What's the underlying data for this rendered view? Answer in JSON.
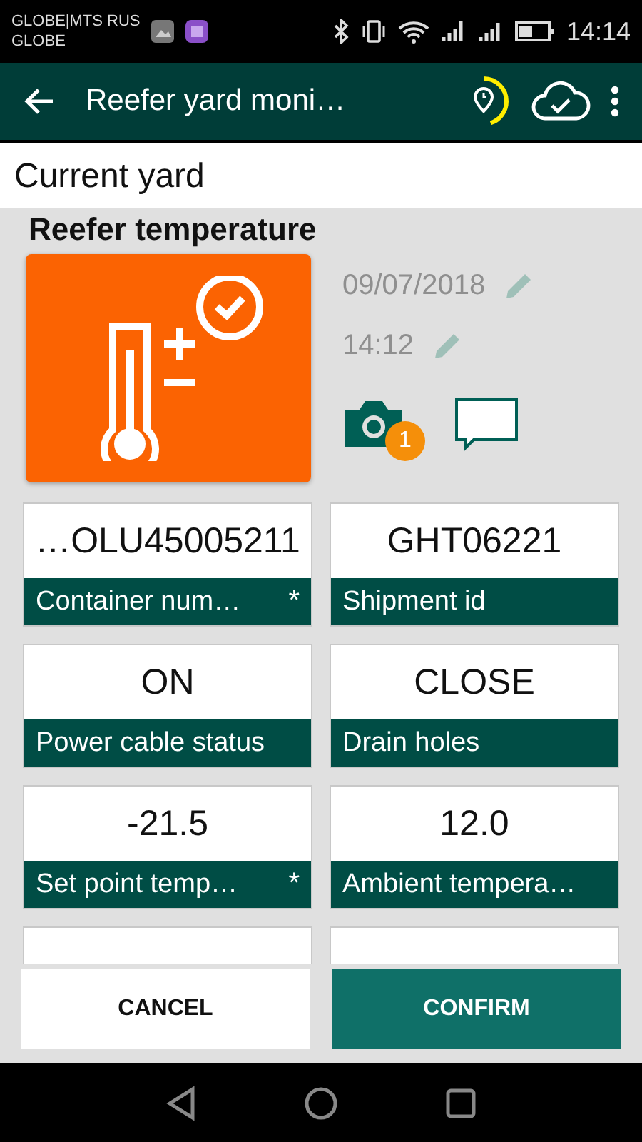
{
  "status_bar": {
    "carrier_lines": [
      "GLOBE|MTS RUS",
      "GLOBE"
    ],
    "time": "14:14"
  },
  "toolbar": {
    "title": "Reefer yard moni…"
  },
  "yard": {
    "label": "Current yard"
  },
  "section": {
    "title": "Reefer temperature",
    "date": "09/07/2018",
    "time": "14:12",
    "photo_count": "1"
  },
  "fields": [
    {
      "value": "…OLU45005211",
      "label": "Container num…",
      "mark": "*"
    },
    {
      "value": "GHT06221",
      "label": "Shipment id"
    },
    {
      "value": "ON",
      "label": "Power cable status"
    },
    {
      "value": "CLOSE",
      "label": "Drain holes"
    },
    {
      "value": "-21.5",
      "label": "Set point temp…",
      "mark": "*"
    },
    {
      "value": "12.0",
      "label": "Ambient tempera…"
    }
  ],
  "buttons": [
    {
      "kind": "secondary",
      "label": "CANCEL"
    },
    {
      "kind": "primary",
      "label": "CONFIRM"
    }
  ]
}
